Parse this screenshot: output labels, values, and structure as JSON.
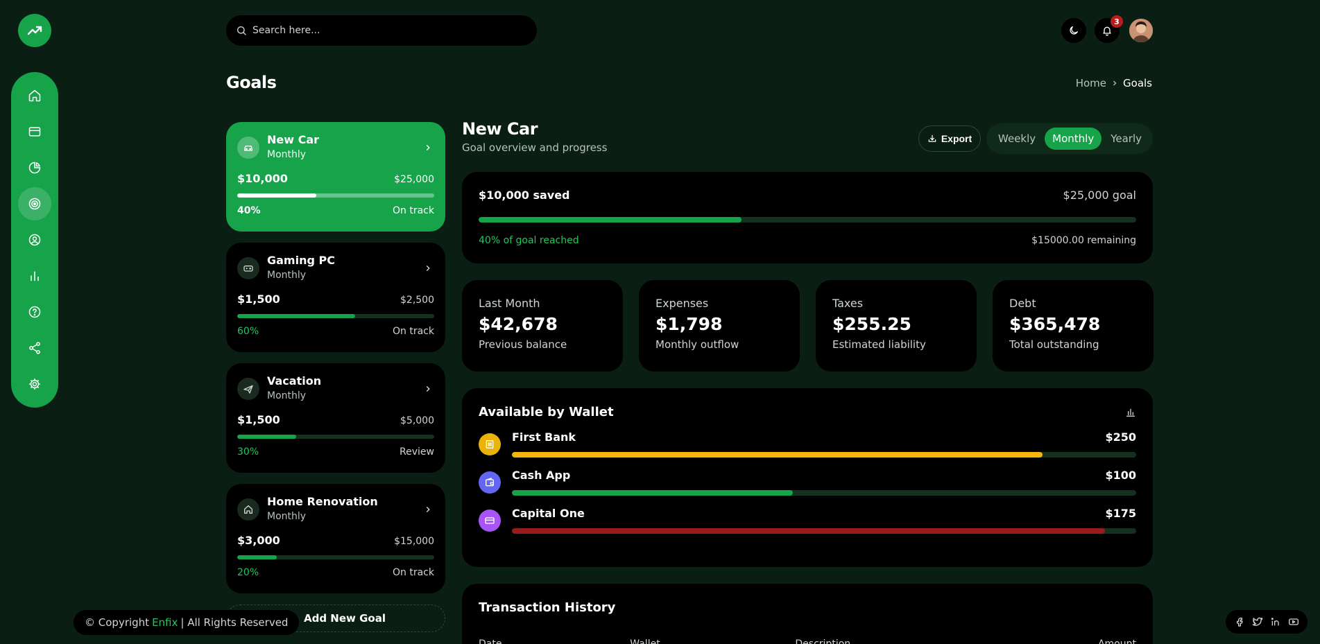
{
  "brand": {
    "name": "Enfix"
  },
  "search": {
    "placeholder": "Search here..."
  },
  "notifications": {
    "count": "3"
  },
  "page": {
    "title": "Goals"
  },
  "breadcrumb": {
    "home": "Home",
    "current": "Goals"
  },
  "sidebar": {
    "items": [
      {
        "icon": "home-icon",
        "active": false
      },
      {
        "icon": "credit-card-icon",
        "active": false
      },
      {
        "icon": "pie-chart-icon",
        "active": false
      },
      {
        "icon": "target-icon",
        "active": true
      },
      {
        "icon": "user-circle-icon",
        "active": false
      },
      {
        "icon": "bar-chart-icon",
        "active": false
      },
      {
        "icon": "help-icon",
        "active": false
      },
      {
        "icon": "share-icon",
        "active": false
      },
      {
        "icon": "gear-icon",
        "active": false
      }
    ]
  },
  "goals": [
    {
      "name": "New Car",
      "period": "Monthly",
      "saved": "$10,000",
      "target": "$25,000",
      "percent": "40%",
      "progress": 0.4,
      "status": "On track",
      "icon": "car-icon",
      "active": true
    },
    {
      "name": "Gaming PC",
      "period": "Monthly",
      "saved": "$1,500",
      "target": "$2,500",
      "percent": "60%",
      "progress": 0.6,
      "status": "On track",
      "icon": "gamepad-icon",
      "active": false
    },
    {
      "name": "Vacation",
      "period": "Monthly",
      "saved": "$1,500",
      "target": "$5,000",
      "percent": "30%",
      "progress": 0.3,
      "status": "Review",
      "icon": "plane-icon",
      "active": false
    },
    {
      "name": "Home Renovation",
      "period": "Monthly",
      "saved": "$3,000",
      "target": "$15,000",
      "percent": "20%",
      "progress": 0.2,
      "status": "On track",
      "icon": "home-icon",
      "active": false
    }
  ],
  "add_goal": {
    "label": "Add New Goal"
  },
  "detail": {
    "title": "New Car",
    "subtitle": "Goal overview and progress",
    "export_label": "Export",
    "periods": [
      "Weekly",
      "Monthly",
      "Yearly"
    ],
    "active_period": "Monthly",
    "progress": {
      "saved": "$10,000 saved",
      "goal": "$25,000 goal",
      "reached": "40% of goal reached",
      "remaining": "$15000.00 remaining",
      "value": 0.4
    },
    "stats": [
      {
        "label": "Last Month",
        "value": "$42,678",
        "sub": "Previous balance"
      },
      {
        "label": "Expenses",
        "value": "$1,798",
        "sub": "Monthly outflow"
      },
      {
        "label": "Taxes",
        "value": "$255.25",
        "sub": "Estimated liability"
      },
      {
        "label": "Debt",
        "value": "$365,478",
        "sub": "Total outstanding"
      }
    ]
  },
  "wallets": {
    "title": "Available by Wallet",
    "items": [
      {
        "name": "First Bank",
        "amount": "$250",
        "progress": 0.85,
        "color": "#f5b50b",
        "icon_bg": "#eab308",
        "icon": "bank-icon"
      },
      {
        "name": "Cash App",
        "amount": "$100",
        "progress": 0.45,
        "color": "#16a34a",
        "icon_bg": "#6366f1",
        "icon": "wallet-icon"
      },
      {
        "name": "Capital One",
        "amount": "$175",
        "progress": 0.95,
        "color": "#991b1b",
        "icon_bg": "#a855f7",
        "icon": "credit-card-icon"
      }
    ]
  },
  "transactions": {
    "title": "Transaction History",
    "columns": [
      "Date",
      "Wallet",
      "Description",
      "Amount"
    ]
  },
  "footer": {
    "copyright_prefix": "© Copyright",
    "brand": "Enfix",
    "copyright_suffix": "| All Rights Reserved",
    "social": [
      "facebook-icon",
      "twitter-icon",
      "linkedin-icon",
      "youtube-icon"
    ]
  },
  "colors": {
    "accent": "#16a34a",
    "background": "#0b1e13",
    "panel": "#000000",
    "danger": "#b91c1c"
  }
}
